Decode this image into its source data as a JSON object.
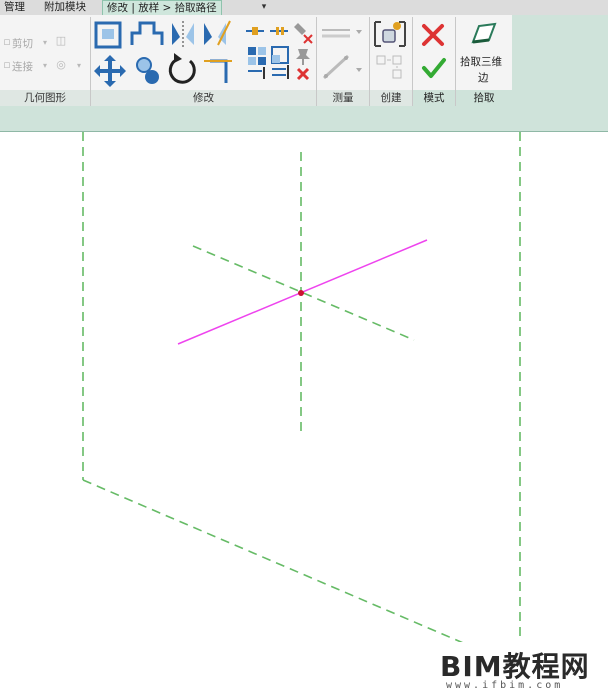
{
  "tabs": [
    {
      "label": "管理",
      "active": false
    },
    {
      "label": "附加模块",
      "active": false
    },
    {
      "label": "修改 | 放样 > 拾取路径",
      "active": true
    }
  ],
  "tab_dropdown": "▾",
  "geometry_panel": {
    "label": "几何图形",
    "cut_label": "剪切",
    "join_label": "连接"
  },
  "modify_panel": {
    "label": "修改"
  },
  "measure_panel": {
    "label": "测量"
  },
  "create_panel": {
    "label": "创建"
  },
  "mode_panel": {
    "label": "模式"
  },
  "pick_panel": {
    "label": "拾取",
    "pick_3d_edges_label_line1": "拾取三维",
    "pick_3d_edges_label_line2": "边"
  },
  "colors": {
    "ribbon_accent": "#cfe3da",
    "reference_line": "#66bb66",
    "path_line": "#ee44ee",
    "endpoint": "#cc1133",
    "cancel": "#dd3333",
    "finish": "#33aa33"
  },
  "watermark": {
    "main": "BIM教程网",
    "sub": "www.ifbim.com"
  }
}
